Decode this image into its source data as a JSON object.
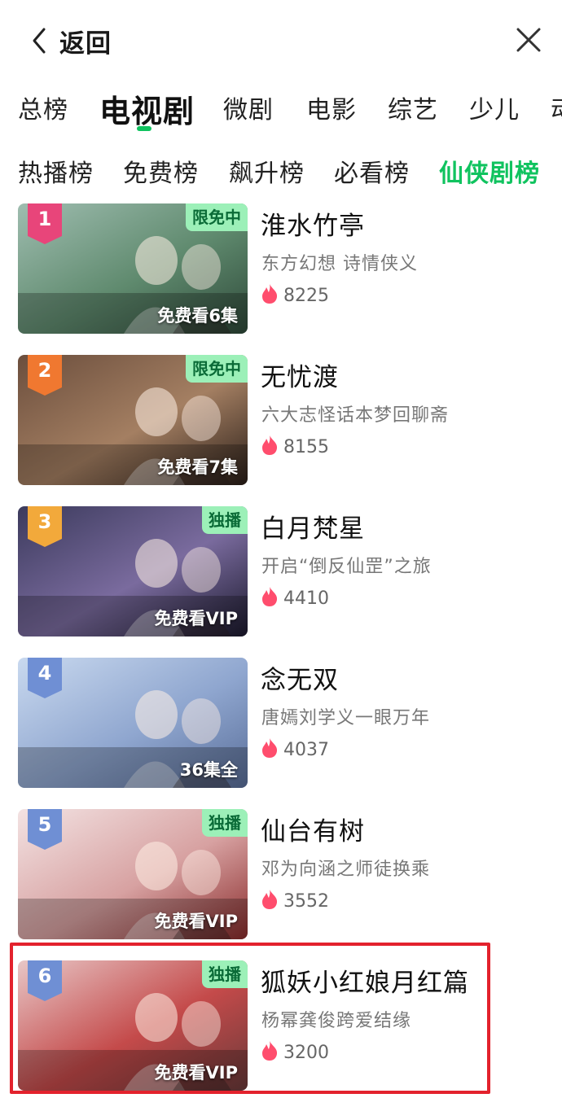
{
  "header": {
    "back_label": "返回"
  },
  "category_tabs": [
    {
      "label": "总榜",
      "active": false
    },
    {
      "label": "电视剧",
      "active": true
    },
    {
      "label": "微剧",
      "active": false
    },
    {
      "label": "电影",
      "active": false
    },
    {
      "label": "综艺",
      "active": false
    },
    {
      "label": "少儿",
      "active": false
    },
    {
      "label": "动",
      "active": false
    }
  ],
  "sub_tabs": [
    {
      "label": "热播榜",
      "active": false
    },
    {
      "label": "免费榜",
      "active": false
    },
    {
      "label": "飙升榜",
      "active": false
    },
    {
      "label": "必看榜",
      "active": false
    },
    {
      "label": "仙侠剧榜",
      "active": true
    }
  ],
  "colors": {
    "accent": "#10c35f",
    "highlight": "#e3222d",
    "tag_bg": "#9cf0b8",
    "flame": "#ff4d6d"
  },
  "rank_list": [
    {
      "rank": "1",
      "rank_color": "#e8457a",
      "corner_tag": "限免中",
      "episode_tag": "免费看6集",
      "title": "淮水竹亭",
      "subtitle": "东方幻想 诗情侠义",
      "heat": "8225",
      "poster_colors": [
        "#9fbdb0",
        "#5f8a6e",
        "#2f4a3a"
      ]
    },
    {
      "rank": "2",
      "rank_color": "#f07830",
      "corner_tag": "限免中",
      "episode_tag": "免费看7集",
      "title": "无忧渡",
      "subtitle": "六大志怪话本梦回聊斋",
      "heat": "8155",
      "poster_colors": [
        "#6b4e3d",
        "#a47f62",
        "#2b1f19"
      ]
    },
    {
      "rank": "3",
      "rank_color": "#f2a93b",
      "corner_tag": "独播",
      "episode_tag": "免费看VIP",
      "title": "白月梵星",
      "subtitle": "开启“倒反仙罡”之旅",
      "heat": "4410",
      "poster_colors": [
        "#3b3a5c",
        "#7a6b9e",
        "#1c1a2e"
      ]
    },
    {
      "rank": "4",
      "rank_color": "#6f8fd4",
      "corner_tag": "",
      "episode_tag": "36集全",
      "title": "念无双",
      "subtitle": "唐嫣刘学义一眼万年",
      "heat": "4037",
      "poster_colors": [
        "#c9d9ef",
        "#8fa6cf",
        "#5a6f9a"
      ]
    },
    {
      "rank": "5",
      "rank_color": "#6f8fd4",
      "corner_tag": "独播",
      "episode_tag": "免费看VIP",
      "title": "仙台有树",
      "subtitle": "邓为向涵之师徒换乘",
      "heat": "3552",
      "poster_colors": [
        "#f3e3e3",
        "#d7a1a1",
        "#8a2c2c"
      ]
    },
    {
      "rank": "6",
      "rank_color": "#6f8fd4",
      "corner_tag": "独播",
      "episode_tag": "免费看VIP",
      "title": "狐妖小红娘月红篇",
      "subtitle": "杨幂龚俊跨爱结缘",
      "heat": "3200",
      "poster_colors": [
        "#e8c7c7",
        "#c44a4a",
        "#6c3a3a"
      ]
    }
  ]
}
